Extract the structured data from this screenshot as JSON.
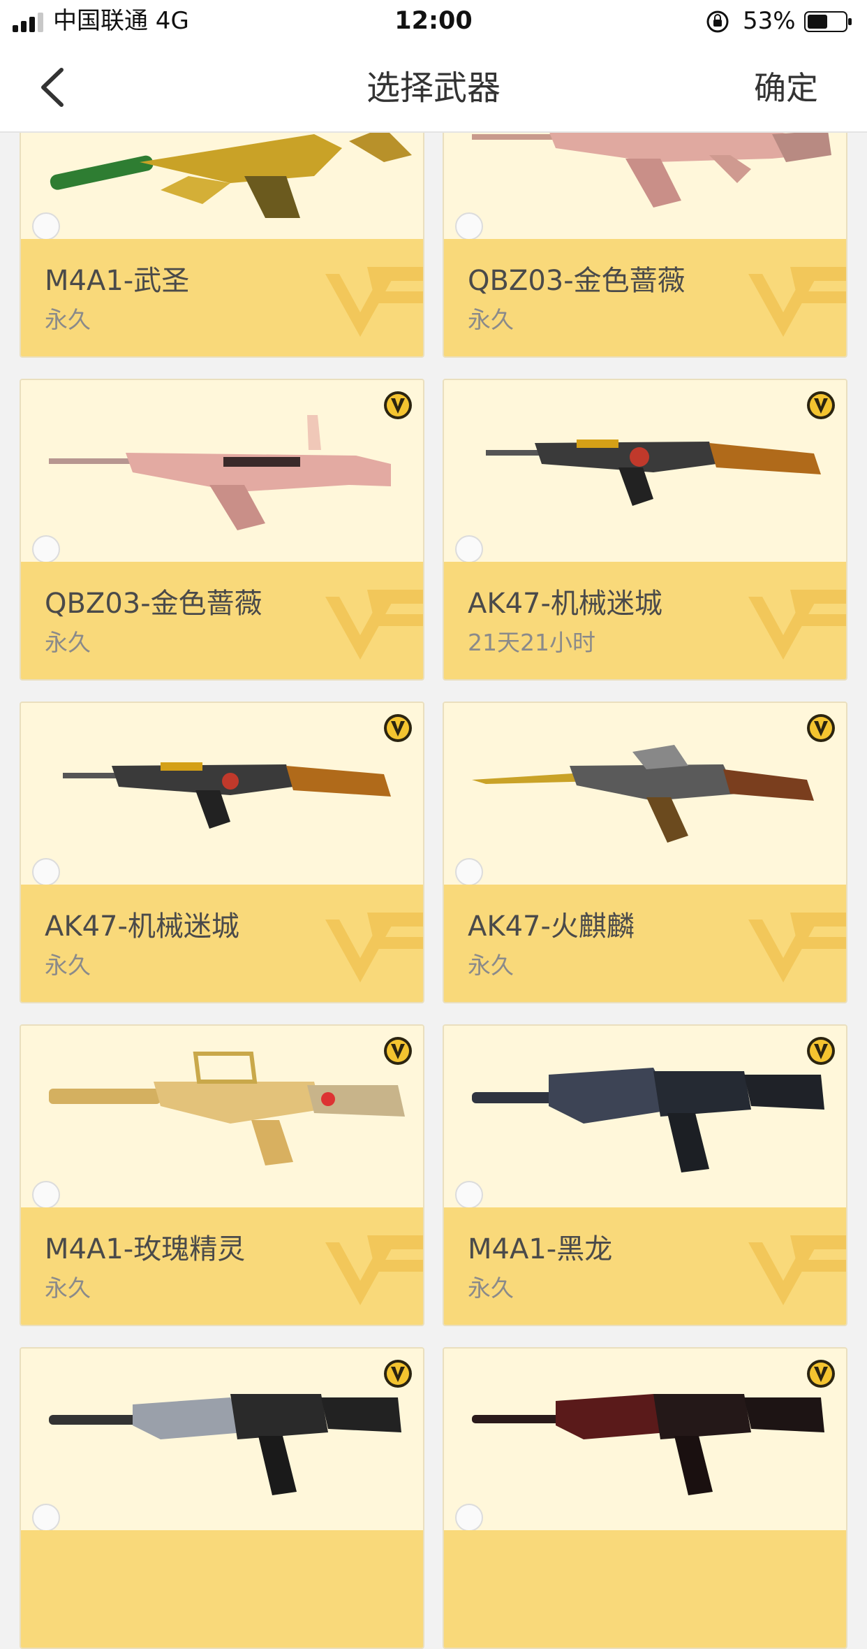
{
  "status_bar": {
    "carrier": "中国联通   4G",
    "time": "12:00",
    "battery": "53%"
  },
  "nav": {
    "title": "选择武器",
    "confirm": "确定"
  },
  "icons": {
    "back": "chevron-left-icon",
    "vip": "v-badge-icon",
    "watermark": "cf-logo-icon"
  },
  "colors": {
    "card_footer": "#f9d97a",
    "card_top": "#fff7da"
  },
  "weapons": [
    {
      "name": "M4A1-武圣",
      "duration": "永久",
      "vip": false
    },
    {
      "name": "QBZ03-金色蔷薇",
      "duration": "永久",
      "vip": false
    },
    {
      "name": "QBZ03-金色蔷薇",
      "duration": "永久",
      "vip": true
    },
    {
      "name": "AK47-机械迷城",
      "duration": "21天21小时",
      "vip": true
    },
    {
      "name": "AK47-机械迷城",
      "duration": "永久",
      "vip": true
    },
    {
      "name": "AK47-火麒麟",
      "duration": "永久",
      "vip": true
    },
    {
      "name": "M4A1-玫瑰精灵",
      "duration": "永久",
      "vip": true
    },
    {
      "name": "M4A1-黑龙",
      "duration": "永久",
      "vip": true
    },
    {
      "name": "",
      "duration": "",
      "vip": true
    },
    {
      "name": "",
      "duration": "",
      "vip": true
    }
  ]
}
